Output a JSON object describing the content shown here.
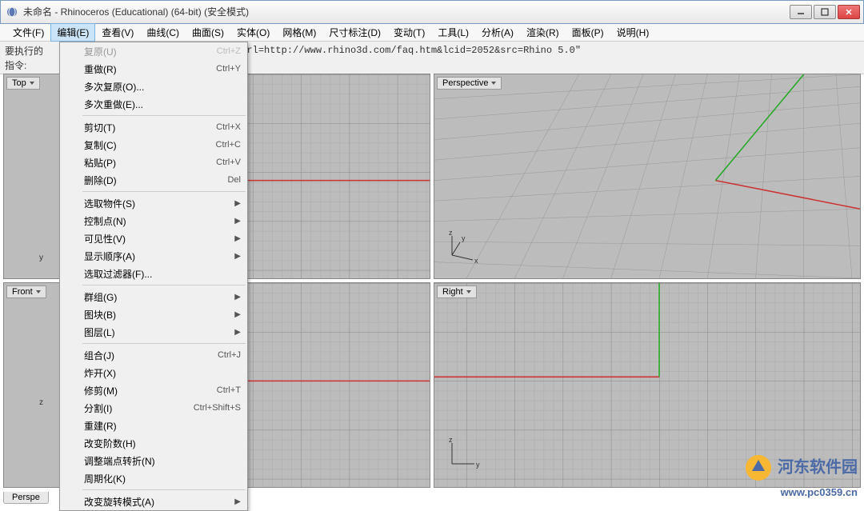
{
  "window": {
    "title": "未命名 - Rhinoceros (Educational) (64-bit) (安全模式)"
  },
  "menubar": [
    {
      "id": "file",
      "label": "文件(F)"
    },
    {
      "id": "edit",
      "label": "编辑(E)"
    },
    {
      "id": "view",
      "label": "查看(V)"
    },
    {
      "id": "curve",
      "label": "曲线(C)"
    },
    {
      "id": "surface",
      "label": "曲面(S)"
    },
    {
      "id": "solid",
      "label": "实体(O)"
    },
    {
      "id": "mesh",
      "label": "网格(M)"
    },
    {
      "id": "dimension",
      "label": "尺寸标注(D)"
    },
    {
      "id": "transform",
      "label": "变动(T)"
    },
    {
      "id": "tools",
      "label": "工具(L)"
    },
    {
      "id": "analyze",
      "label": "分析(A)"
    },
    {
      "id": "render",
      "label": "渲染(R)"
    },
    {
      "id": "panels",
      "label": "面板(P)"
    },
    {
      "id": "help",
      "label": "说明(H)"
    }
  ],
  "command": {
    "row1_label": "要执行的",
    "row1_value": "?url=http://www.rhino3d.com/faq.htm&lcid=2052&src=Rhino 5.0\"",
    "row2_label": "指令:"
  },
  "editMenu": [
    {
      "type": "item",
      "label": "复原(U)",
      "shortcut": "Ctrl+Z",
      "disabled": true
    },
    {
      "type": "item",
      "label": "重做(R)",
      "shortcut": "Ctrl+Y"
    },
    {
      "type": "item",
      "label": "多次复原(O)..."
    },
    {
      "type": "item",
      "label": "多次重做(E)..."
    },
    {
      "type": "sep"
    },
    {
      "type": "item",
      "label": "剪切(T)",
      "shortcut": "Ctrl+X"
    },
    {
      "type": "item",
      "label": "复制(C)",
      "shortcut": "Ctrl+C"
    },
    {
      "type": "item",
      "label": "粘贴(P)",
      "shortcut": "Ctrl+V"
    },
    {
      "type": "item",
      "label": "删除(D)",
      "shortcut": "Del"
    },
    {
      "type": "sep"
    },
    {
      "type": "item",
      "label": "选取物件(S)",
      "submenu": true
    },
    {
      "type": "item",
      "label": "控制点(N)",
      "submenu": true
    },
    {
      "type": "item",
      "label": "可见性(V)",
      "submenu": true
    },
    {
      "type": "item",
      "label": "显示顺序(A)",
      "submenu": true
    },
    {
      "type": "item",
      "label": "选取过滤器(F)..."
    },
    {
      "type": "sep"
    },
    {
      "type": "item",
      "label": "群组(G)",
      "submenu": true
    },
    {
      "type": "item",
      "label": "图块(B)",
      "submenu": true
    },
    {
      "type": "item",
      "label": "图层(L)",
      "submenu": true
    },
    {
      "type": "sep"
    },
    {
      "type": "item",
      "label": "组合(J)",
      "shortcut": "Ctrl+J"
    },
    {
      "type": "item",
      "label": "炸开(X)"
    },
    {
      "type": "item",
      "label": "修剪(M)",
      "shortcut": "Ctrl+T"
    },
    {
      "type": "item",
      "label": "分割(I)",
      "shortcut": "Ctrl+Shift+S"
    },
    {
      "type": "item",
      "label": "重建(R)"
    },
    {
      "type": "item",
      "label": "改变阶数(H)"
    },
    {
      "type": "item",
      "label": "调整端点转折(N)"
    },
    {
      "type": "item",
      "label": "周期化(K)"
    },
    {
      "type": "sep"
    },
    {
      "type": "item",
      "label": "改变旋转模式(A)",
      "submenu": true
    }
  ],
  "viewports": {
    "tl": {
      "label": "Top"
    },
    "tr": {
      "label": "Perspective"
    },
    "bl": {
      "label": "Front"
    },
    "br": {
      "label": "Right"
    }
  },
  "axes": {
    "x": "x",
    "y": "y",
    "z": "z"
  },
  "tabs": {
    "perspective": "Perspe"
  },
  "watermark": {
    "text": "河东软件园",
    "url": "www.pc0359.cn"
  }
}
